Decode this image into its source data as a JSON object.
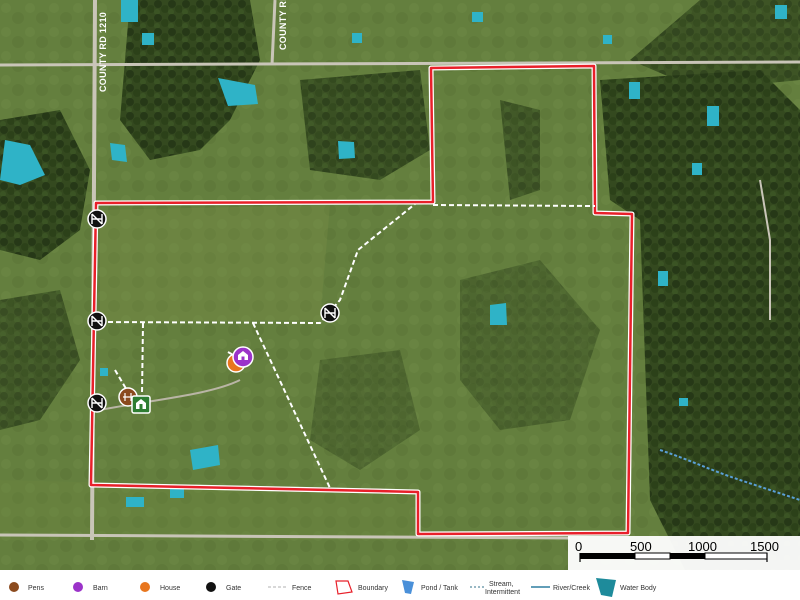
{
  "map": {
    "roads": [
      "COUNTY RD 1210",
      "COUNTY RD"
    ],
    "colors": {
      "boundary": "#e8202a",
      "fence": "#ffffff",
      "water_body": "#2fb3c7",
      "pond": "#4a90d9",
      "stream": "#5aa0d8",
      "pens": "#8b4a1e",
      "barn": "#9b33c9",
      "house": "#e8761e",
      "gate": "#111111",
      "grass": "#5a7a3a",
      "trees": "#2a3a1c"
    },
    "markers": [
      {
        "type": "gate",
        "icon": "gate-icon"
      },
      {
        "type": "gate",
        "icon": "gate-icon"
      },
      {
        "type": "gate",
        "icon": "gate-icon"
      },
      {
        "type": "gate",
        "icon": "gate-icon"
      },
      {
        "type": "barn",
        "icon": "barn-icon"
      },
      {
        "type": "house",
        "icon": "house-icon"
      },
      {
        "type": "pens",
        "icon": "pens-icon"
      },
      {
        "type": "house",
        "icon": "house-icon"
      }
    ]
  },
  "scale": {
    "ticks": [
      "0",
      "500",
      "1000",
      "1500"
    ]
  },
  "legend": {
    "items": [
      {
        "label": "Pens",
        "icon": "pens-icon"
      },
      {
        "label": "Barn",
        "icon": "barn-icon"
      },
      {
        "label": "House",
        "icon": "house-icon"
      },
      {
        "label": "Gate",
        "icon": "gate-icon"
      },
      {
        "label": "Fence",
        "icon": "fence-icon"
      },
      {
        "label": "Boundary",
        "icon": "boundary-icon"
      },
      {
        "label": "Pond / Tank",
        "icon": "pond-icon"
      },
      {
        "label": "Stream,",
        "label2": "Intermittent",
        "icon": "stream-icon"
      },
      {
        "label": "River/Creek",
        "icon": "river-icon"
      },
      {
        "label": "Water Body",
        "icon": "water-body-icon"
      }
    ]
  }
}
